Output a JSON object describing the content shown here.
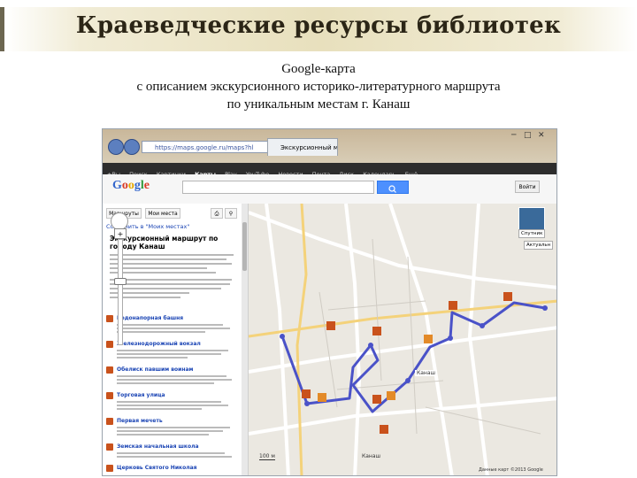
{
  "slide": {
    "title": "Краеведческие ресурсы библиотек",
    "subtitle_lines": [
      "Google-карта",
      "с описанием экскурсионного историко-литературного маршрута",
      "по уникальным местам г. Канаш"
    ]
  },
  "browser": {
    "url": "https://maps.google.ru/maps?hl",
    "tab_label": "Экскурсионный ма...",
    "google_bar": [
      "+Вы",
      "Поиск",
      "Картинки",
      "Карты",
      "Play",
      "YouTube",
      "Новости",
      "Почта",
      "Диск",
      "Календарь",
      "Ещё"
    ],
    "google_bar_active": 3
  },
  "maps": {
    "logo": [
      "G",
      "o",
      "o",
      "g",
      "l",
      "e"
    ],
    "login_label": "Войти",
    "panel": {
      "route_button": "Маршруты",
      "my_places_button": "Мои места",
      "save_link": "Сохранить в \"Моих местах\"",
      "map_title": "Экскурсионный маршрут по городу Канаш",
      "places": [
        "Водонапорная башня",
        "Железнодорожный вокзал",
        "Обелиск павшим воинам",
        "Торговая улица",
        "Первая мечеть",
        "Земская начальная школа",
        "Церковь Святого Николая"
      ]
    },
    "map": {
      "city_label": "Канаш",
      "district_label": "Канаш",
      "satellite_label": "Спутник",
      "traffic_label": "Актуальн",
      "scale_label": "100 м",
      "copyright": "Данные карт ©2013 Google",
      "route_color": "#4a52c8",
      "road_color": "#ffffff"
    }
  }
}
